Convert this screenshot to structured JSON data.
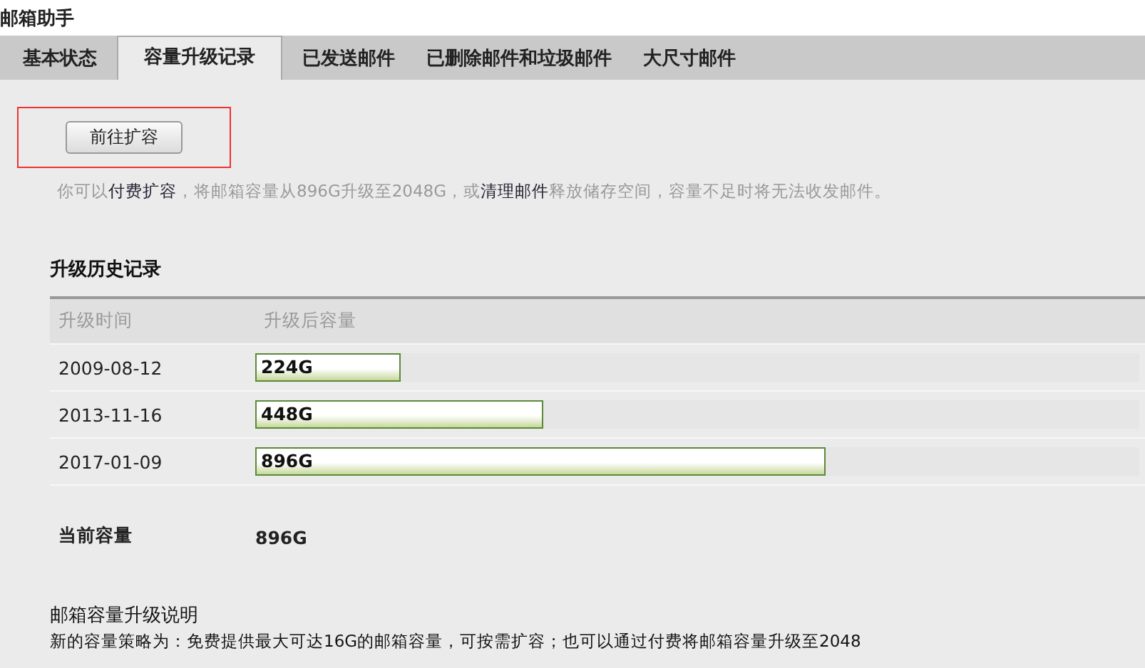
{
  "window": {
    "title": "邮箱助手"
  },
  "tabs": [
    {
      "label": "基本状态",
      "selected": false
    },
    {
      "label": "容量升级记录",
      "selected": true
    },
    {
      "label": "已发送邮件",
      "selected": false
    },
    {
      "label": "已删除邮件和垃圾邮件",
      "selected": false
    },
    {
      "label": "大尺寸邮件",
      "selected": false
    }
  ],
  "expand_button": {
    "label": "前往扩容",
    "highlighted": true
  },
  "notice": [
    {
      "kind": "text",
      "text": "你可以"
    },
    {
      "kind": "link",
      "text": "付费扩容"
    },
    {
      "kind": "text",
      "text": "，将邮箱容量从896G升级至2048G，或"
    },
    {
      "kind": "link",
      "text": "清理邮件"
    },
    {
      "kind": "text",
      "text": "释放储存空间，容量不足时将无法收发邮件。"
    }
  ],
  "history": {
    "title": "升级历史记录",
    "columns": [
      "升级时间",
      "升级后容量"
    ],
    "rows": [
      {
        "date": "2009-08-12",
        "capacity": "224G",
        "level": 0.165
      },
      {
        "date": "2013-11-16",
        "capacity": "448G",
        "level": 0.325
      },
      {
        "date": "2017-01-09",
        "capacity": "896G",
        "level": 0.645
      }
    ],
    "current": {
      "label": "当前容量",
      "value": "896G"
    }
  },
  "explanation": {
    "title": "邮箱容量升级说明",
    "text": "新的容量策略为：免费提供最大可达16G的邮箱容量，可按需扩容；也可以通过付费将邮箱容量升级至2048"
  }
}
